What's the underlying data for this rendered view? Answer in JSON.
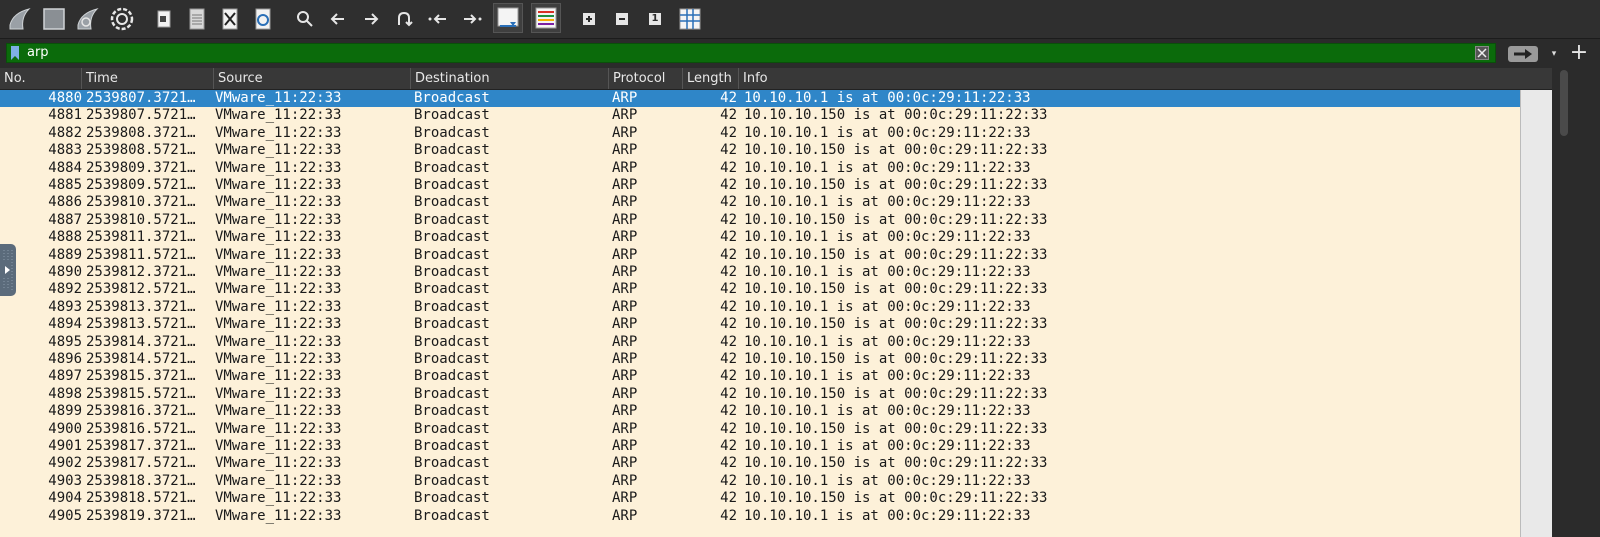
{
  "toolbar": {
    "buttons": [
      {
        "name": "start-capture-button",
        "icon": "shark-fin-icon"
      },
      {
        "name": "stop-capture-button",
        "icon": "stop-square-icon"
      },
      {
        "name": "restart-capture-button",
        "icon": "restart-fin-icon"
      },
      {
        "name": "capture-options-button",
        "icon": "gear-icon"
      },
      {
        "name": "open-file-button",
        "icon": "open-file-icon"
      },
      {
        "name": "save-file-button",
        "icon": "save-file-icon"
      },
      {
        "name": "close-file-button",
        "icon": "close-file-icon"
      },
      {
        "name": "reload-file-button",
        "icon": "reload-icon"
      },
      {
        "name": "find-packet-button",
        "icon": "search-icon"
      },
      {
        "name": "go-back-button",
        "icon": "arrow-left-icon"
      },
      {
        "name": "go-forward-button",
        "icon": "arrow-right-icon"
      },
      {
        "name": "go-to-packet-button",
        "icon": "go-to-packet-icon"
      },
      {
        "name": "first-packet-button",
        "icon": "first-packet-icon"
      },
      {
        "name": "last-packet-button",
        "icon": "last-packet-icon"
      },
      {
        "name": "auto-scroll-button",
        "icon": "auto-scroll-icon"
      },
      {
        "name": "colorize-button",
        "icon": "colorize-icon"
      },
      {
        "name": "zoom-in-button",
        "icon": "zoom-in-icon"
      },
      {
        "name": "zoom-out-button",
        "icon": "zoom-out-icon"
      },
      {
        "name": "normal-size-button",
        "icon": "normal-size-icon"
      },
      {
        "name": "resize-columns-button",
        "icon": "resize-columns-icon"
      }
    ],
    "normal_size_label": "1"
  },
  "filter": {
    "value": "arp",
    "bar_color": "#0b6b0b"
  },
  "columns": [
    "No.",
    "Time",
    "Source",
    "Destination",
    "Protocol",
    "Length",
    "Info"
  ],
  "packets": [
    {
      "no": "4880",
      "time": "2539807.3721…",
      "src": "VMware_11:22:33",
      "dst": "Broadcast",
      "proto": "ARP",
      "len": "42",
      "info": "10.10.10.1 is at 00:0c:29:11:22:33",
      "selected": true
    },
    {
      "no": "4881",
      "time": "2539807.5721…",
      "src": "VMware_11:22:33",
      "dst": "Broadcast",
      "proto": "ARP",
      "len": "42",
      "info": "10.10.10.150 is at 00:0c:29:11:22:33"
    },
    {
      "no": "4882",
      "time": "2539808.3721…",
      "src": "VMware_11:22:33",
      "dst": "Broadcast",
      "proto": "ARP",
      "len": "42",
      "info": "10.10.10.1 is at 00:0c:29:11:22:33"
    },
    {
      "no": "4883",
      "time": "2539808.5721…",
      "src": "VMware_11:22:33",
      "dst": "Broadcast",
      "proto": "ARP",
      "len": "42",
      "info": "10.10.10.150 is at 00:0c:29:11:22:33"
    },
    {
      "no": "4884",
      "time": "2539809.3721…",
      "src": "VMware_11:22:33",
      "dst": "Broadcast",
      "proto": "ARP",
      "len": "42",
      "info": "10.10.10.1 is at 00:0c:29:11:22:33"
    },
    {
      "no": "4885",
      "time": "2539809.5721…",
      "src": "VMware_11:22:33",
      "dst": "Broadcast",
      "proto": "ARP",
      "len": "42",
      "info": "10.10.10.150 is at 00:0c:29:11:22:33"
    },
    {
      "no": "4886",
      "time": "2539810.3721…",
      "src": "VMware_11:22:33",
      "dst": "Broadcast",
      "proto": "ARP",
      "len": "42",
      "info": "10.10.10.1 is at 00:0c:29:11:22:33"
    },
    {
      "no": "4887",
      "time": "2539810.5721…",
      "src": "VMware_11:22:33",
      "dst": "Broadcast",
      "proto": "ARP",
      "len": "42",
      "info": "10.10.10.150 is at 00:0c:29:11:22:33"
    },
    {
      "no": "4888",
      "time": "2539811.3721…",
      "src": "VMware_11:22:33",
      "dst": "Broadcast",
      "proto": "ARP",
      "len": "42",
      "info": "10.10.10.1 is at 00:0c:29:11:22:33"
    },
    {
      "no": "4889",
      "time": "2539811.5721…",
      "src": "VMware_11:22:33",
      "dst": "Broadcast",
      "proto": "ARP",
      "len": "42",
      "info": "10.10.10.150 is at 00:0c:29:11:22:33"
    },
    {
      "no": "4890",
      "time": "2539812.3721…",
      "src": "VMware_11:22:33",
      "dst": "Broadcast",
      "proto": "ARP",
      "len": "42",
      "info": "10.10.10.1 is at 00:0c:29:11:22:33"
    },
    {
      "no": "4892",
      "time": "2539812.5721…",
      "src": "VMware_11:22:33",
      "dst": "Broadcast",
      "proto": "ARP",
      "len": "42",
      "info": "10.10.10.150 is at 00:0c:29:11:22:33"
    },
    {
      "no": "4893",
      "time": "2539813.3721…",
      "src": "VMware_11:22:33",
      "dst": "Broadcast",
      "proto": "ARP",
      "len": "42",
      "info": "10.10.10.1 is at 00:0c:29:11:22:33"
    },
    {
      "no": "4894",
      "time": "2539813.5721…",
      "src": "VMware_11:22:33",
      "dst": "Broadcast",
      "proto": "ARP",
      "len": "42",
      "info": "10.10.10.150 is at 00:0c:29:11:22:33"
    },
    {
      "no": "4895",
      "time": "2539814.3721…",
      "src": "VMware_11:22:33",
      "dst": "Broadcast",
      "proto": "ARP",
      "len": "42",
      "info": "10.10.10.1 is at 00:0c:29:11:22:33"
    },
    {
      "no": "4896",
      "time": "2539814.5721…",
      "src": "VMware_11:22:33",
      "dst": "Broadcast",
      "proto": "ARP",
      "len": "42",
      "info": "10.10.10.150 is at 00:0c:29:11:22:33"
    },
    {
      "no": "4897",
      "time": "2539815.3721…",
      "src": "VMware_11:22:33",
      "dst": "Broadcast",
      "proto": "ARP",
      "len": "42",
      "info": "10.10.10.1 is at 00:0c:29:11:22:33"
    },
    {
      "no": "4898",
      "time": "2539815.5721…",
      "src": "VMware_11:22:33",
      "dst": "Broadcast",
      "proto": "ARP",
      "len": "42",
      "info": "10.10.10.150 is at 00:0c:29:11:22:33"
    },
    {
      "no": "4899",
      "time": "2539816.3721…",
      "src": "VMware_11:22:33",
      "dst": "Broadcast",
      "proto": "ARP",
      "len": "42",
      "info": "10.10.10.1 is at 00:0c:29:11:22:33"
    },
    {
      "no": "4900",
      "time": "2539816.5721…",
      "src": "VMware_11:22:33",
      "dst": "Broadcast",
      "proto": "ARP",
      "len": "42",
      "info": "10.10.10.150 is at 00:0c:29:11:22:33"
    },
    {
      "no": "4901",
      "time": "2539817.3721…",
      "src": "VMware_11:22:33",
      "dst": "Broadcast",
      "proto": "ARP",
      "len": "42",
      "info": "10.10.10.1 is at 00:0c:29:11:22:33"
    },
    {
      "no": "4902",
      "time": "2539817.5721…",
      "src": "VMware_11:22:33",
      "dst": "Broadcast",
      "proto": "ARP",
      "len": "42",
      "info": "10.10.10.150 is at 00:0c:29:11:22:33"
    },
    {
      "no": "4903",
      "time": "2539818.3721…",
      "src": "VMware_11:22:33",
      "dst": "Broadcast",
      "proto": "ARP",
      "len": "42",
      "info": "10.10.10.1 is at 00:0c:29:11:22:33"
    },
    {
      "no": "4904",
      "time": "2539818.5721…",
      "src": "VMware_11:22:33",
      "dst": "Broadcast",
      "proto": "ARP",
      "len": "42",
      "info": "10.10.10.150 is at 00:0c:29:11:22:33"
    },
    {
      "no": "4905",
      "time": "2539819.3721…",
      "src": "VMware_11:22:33",
      "dst": "Broadcast",
      "proto": "ARP",
      "len": "42",
      "info": "10.10.10.1 is at 00:0c:29:11:22:33"
    }
  ],
  "colors": {
    "row_background": "#fdf1d9",
    "selected_row": "#2f86c8",
    "toolbar": "#2f2f2f"
  }
}
